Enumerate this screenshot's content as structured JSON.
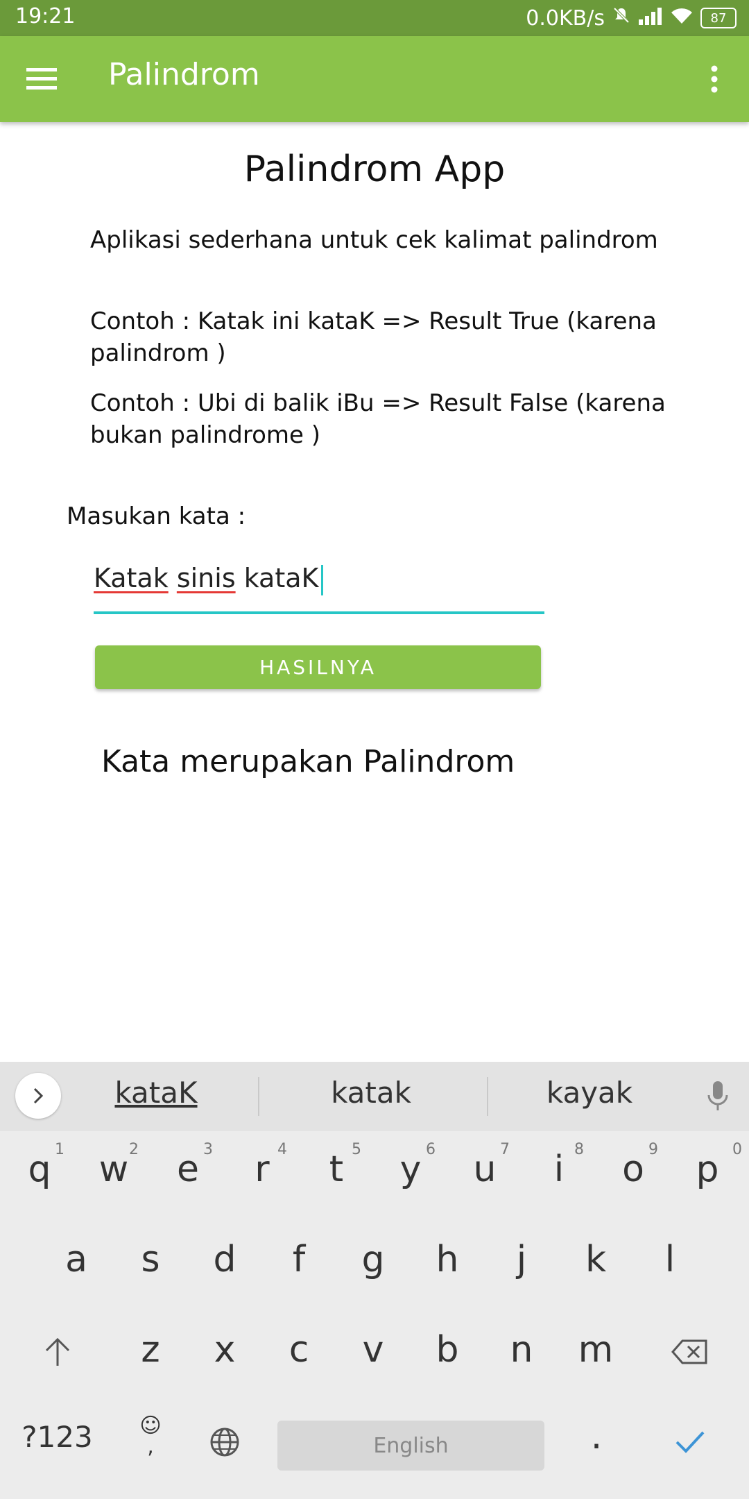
{
  "status_bar": {
    "time": "19:21",
    "network_speed": "0.0KB/s",
    "battery": "87"
  },
  "toolbar": {
    "title": "Palindrom",
    "menu_icon": "hamburger-icon",
    "overflow_icon": "more-vert-icon"
  },
  "content": {
    "app_title": "Palindrom App",
    "description": "Aplikasi sederhana untuk cek kalimat palindrom",
    "example1": "Contoh : Katak ini kataK  => Result True (karena palindrom )",
    "example2": "Contoh : Ubi di balik iBu => Result False (karena bukan palindrome )",
    "input_label": "Masukan kata :",
    "input_value": {
      "w1": "Katak",
      "sp1": " ",
      "w2": "sinis",
      "sp2": " ",
      "w3": "kataK"
    },
    "button_label": "HASILNYA",
    "result_text": "Kata merupakan Palindrom"
  },
  "keyboard": {
    "suggestions": [
      "kataK",
      "katak",
      "kayak"
    ],
    "row1": [
      {
        "k": "q",
        "h": "1"
      },
      {
        "k": "w",
        "h": "2"
      },
      {
        "k": "e",
        "h": "3"
      },
      {
        "k": "r",
        "h": "4"
      },
      {
        "k": "t",
        "h": "5"
      },
      {
        "k": "y",
        "h": "6"
      },
      {
        "k": "u",
        "h": "7"
      },
      {
        "k": "i",
        "h": "8"
      },
      {
        "k": "o",
        "h": "9"
      },
      {
        "k": "p",
        "h": "0"
      }
    ],
    "row2": [
      "a",
      "s",
      "d",
      "f",
      "g",
      "h",
      "j",
      "k",
      "l"
    ],
    "row3": [
      "z",
      "x",
      "c",
      "v",
      "b",
      "n",
      "m"
    ],
    "symbols_label": "?123",
    "emoji_top": "☺",
    "emoji_bottom": ",",
    "space_label": "English",
    "period_label": "."
  },
  "colors": {
    "status_bar": "#6b9a3a",
    "primary": "#8bc34a",
    "accent": "#26c6c6",
    "keyboard_bg": "#ececec"
  }
}
